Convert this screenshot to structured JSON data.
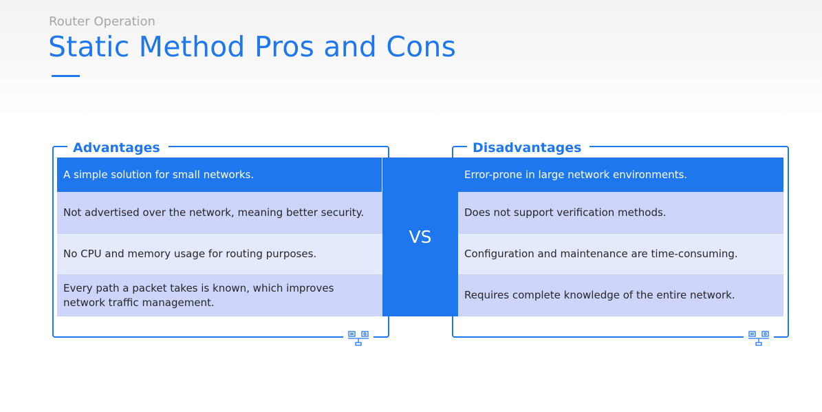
{
  "header": {
    "subtitle": "Router Operation",
    "title": "Static Method Pros and Cons"
  },
  "advantages": {
    "label": "Advantages",
    "items": [
      "A simple solution for small networks.",
      "Not advertised over the network, meaning better security.",
      "No CPU and memory usage for routing purposes.",
      "Every path a packet takes is known, which improves network traffic management."
    ],
    "icon": "network-balance-icon"
  },
  "versus": {
    "label": "VS"
  },
  "disadvantages": {
    "label": "Disadvantages",
    "items": [
      "Error-prone in large network environments.",
      "Does not support verification methods.",
      "Configuration and maintenance are time-consuming.",
      "Requires complete knowledge of the entire network."
    ],
    "icon": "network-balance-icon"
  },
  "colors": {
    "accent": "#1f77ed",
    "row_dark": "#cdd6fa",
    "row_light": "#e4eafc",
    "subtitle": "#a6a6a6",
    "text": "#262626"
  }
}
